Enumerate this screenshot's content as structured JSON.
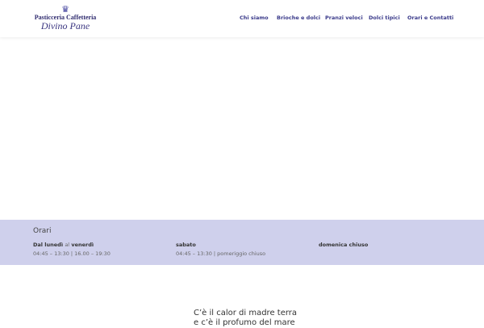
{
  "logo": {
    "line1": "Pasticceria Caffetteria",
    "line2": "Divino Pane",
    "crown": "♛"
  },
  "nav": [
    "Chi siamo",
    "Brioche e dolci",
    "Pranzi veloci",
    "Dolci tipici",
    "Orari e Contatti"
  ],
  "orari": {
    "title": "Orari",
    "weekday": {
      "from": "Dal lunedì",
      "sep": "al",
      "to": "venerdì",
      "hours": "04:45 – 13:30 | 16.00 – 19:30"
    },
    "saturday": {
      "label": "sabato",
      "hours": "04:45 – 13:30 | pomeriggio chiuso"
    },
    "sunday": {
      "label": "domenica chiuso"
    }
  },
  "quote": {
    "line1": "C’è il calor di madre terra",
    "line2": "e c’è il profumo del mare"
  }
}
